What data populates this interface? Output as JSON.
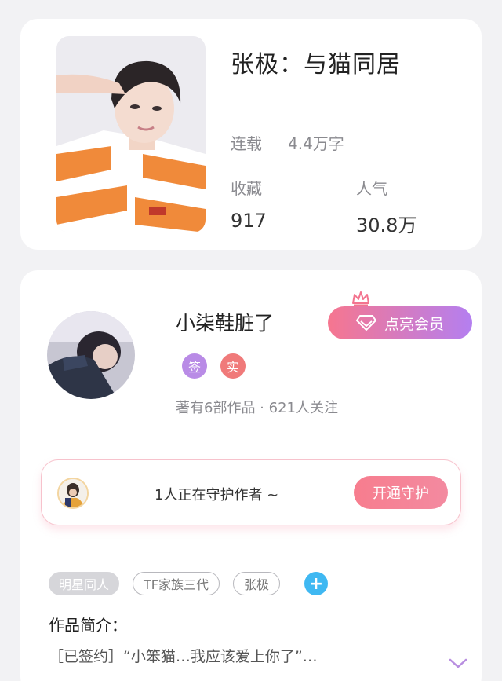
{
  "book": {
    "title": "张极：与猫同居",
    "status": "连载",
    "word_count": "4.4万字",
    "favorites_label": "收藏",
    "favorites_value": "917",
    "popularity_label": "人气",
    "popularity_value": "30.8万"
  },
  "author": {
    "name": "小柒鞋脏了",
    "badge_signed": "签",
    "badge_real": "实",
    "meta": "著有6部作品 · 621人关注",
    "vip_button": "点亮会员"
  },
  "guard": {
    "text": "1人正在守护作者 ~",
    "button": "开通守护"
  },
  "tags": [
    "明星同人",
    "TF家族三代",
    "张极"
  ],
  "tag_add": "+",
  "intro": {
    "heading": "作品简介：",
    "text": "［已签约］“小笨猫…我应该爱上你了”…"
  },
  "colors": {
    "vip_gradient_start": "#f6768f",
    "vip_gradient_end": "#b47ff0",
    "guard_button": "#f77d8e",
    "tag_add": "#3fb8f2",
    "badge_signed": "#b98be6",
    "badge_real": "#f07a7a"
  }
}
